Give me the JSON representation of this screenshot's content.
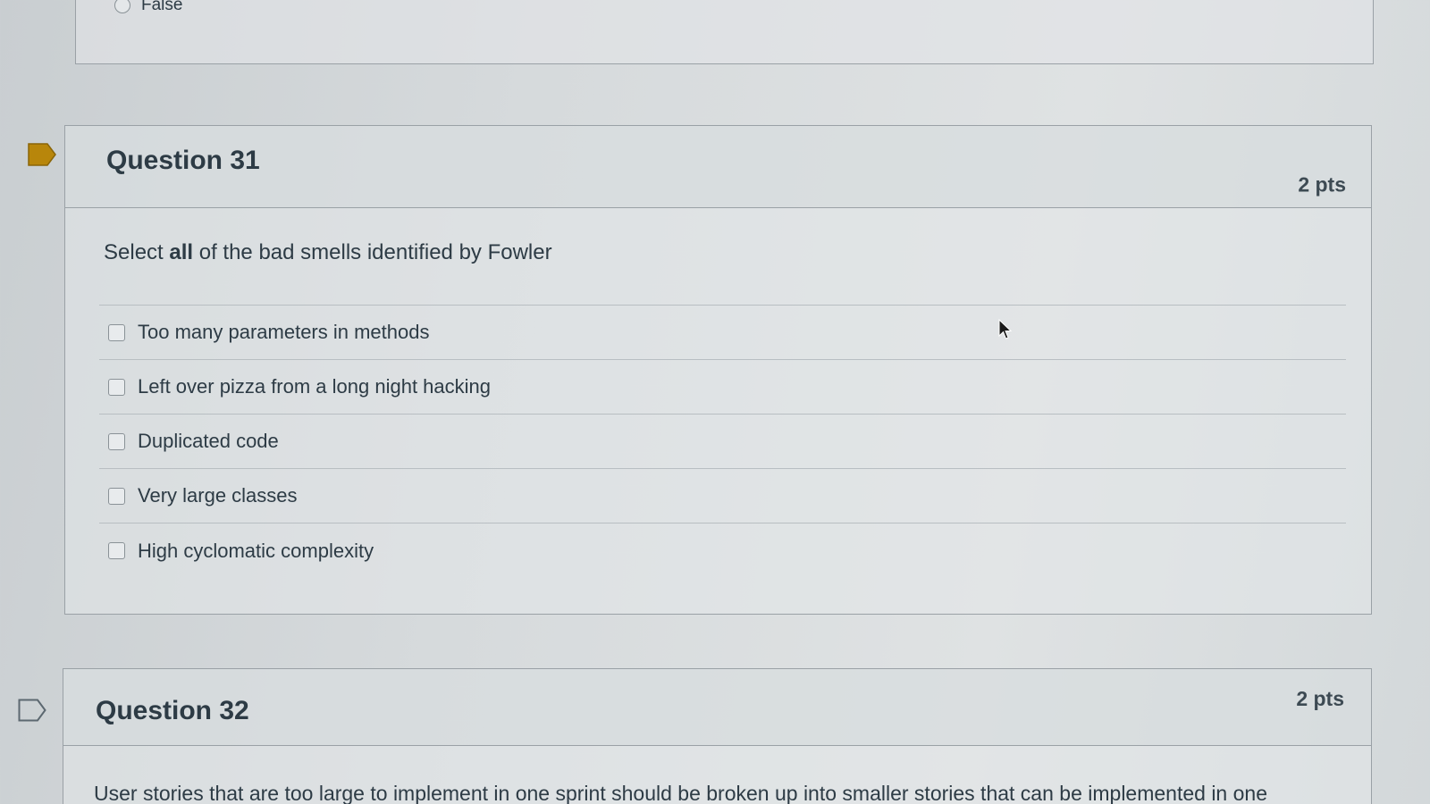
{
  "previous_question": {
    "option_label": "False"
  },
  "question31": {
    "title": "Question 31",
    "points": "2 pts",
    "prompt_before": "Select ",
    "prompt_bold": "all",
    "prompt_after": " of the bad smells identified by Fowler",
    "flagged": true,
    "answers": [
      {
        "label": "Too many parameters in methods",
        "checked": false
      },
      {
        "label": "Left over pizza from a long night hacking",
        "checked": false
      },
      {
        "label": "Duplicated code",
        "checked": false
      },
      {
        "label": "Very large classes",
        "checked": false
      },
      {
        "label": "High cyclomatic complexity",
        "checked": false
      }
    ]
  },
  "question32": {
    "title": "Question 32",
    "points": "2 pts",
    "flagged": false,
    "prompt_partial": "User stories that are too large to implement in one sprint should be broken up into smaller stories that can be implemented in one"
  },
  "icons": {
    "flag_filled": "flag-filled-icon",
    "flag_outline": "flag-outline-icon",
    "cursor": "mouse-pointer-icon"
  },
  "colors": {
    "flag_filled": "#b8860b",
    "flag_outline": "#5c6870",
    "text": "#2d3b45",
    "border": "#9aa1a6"
  }
}
